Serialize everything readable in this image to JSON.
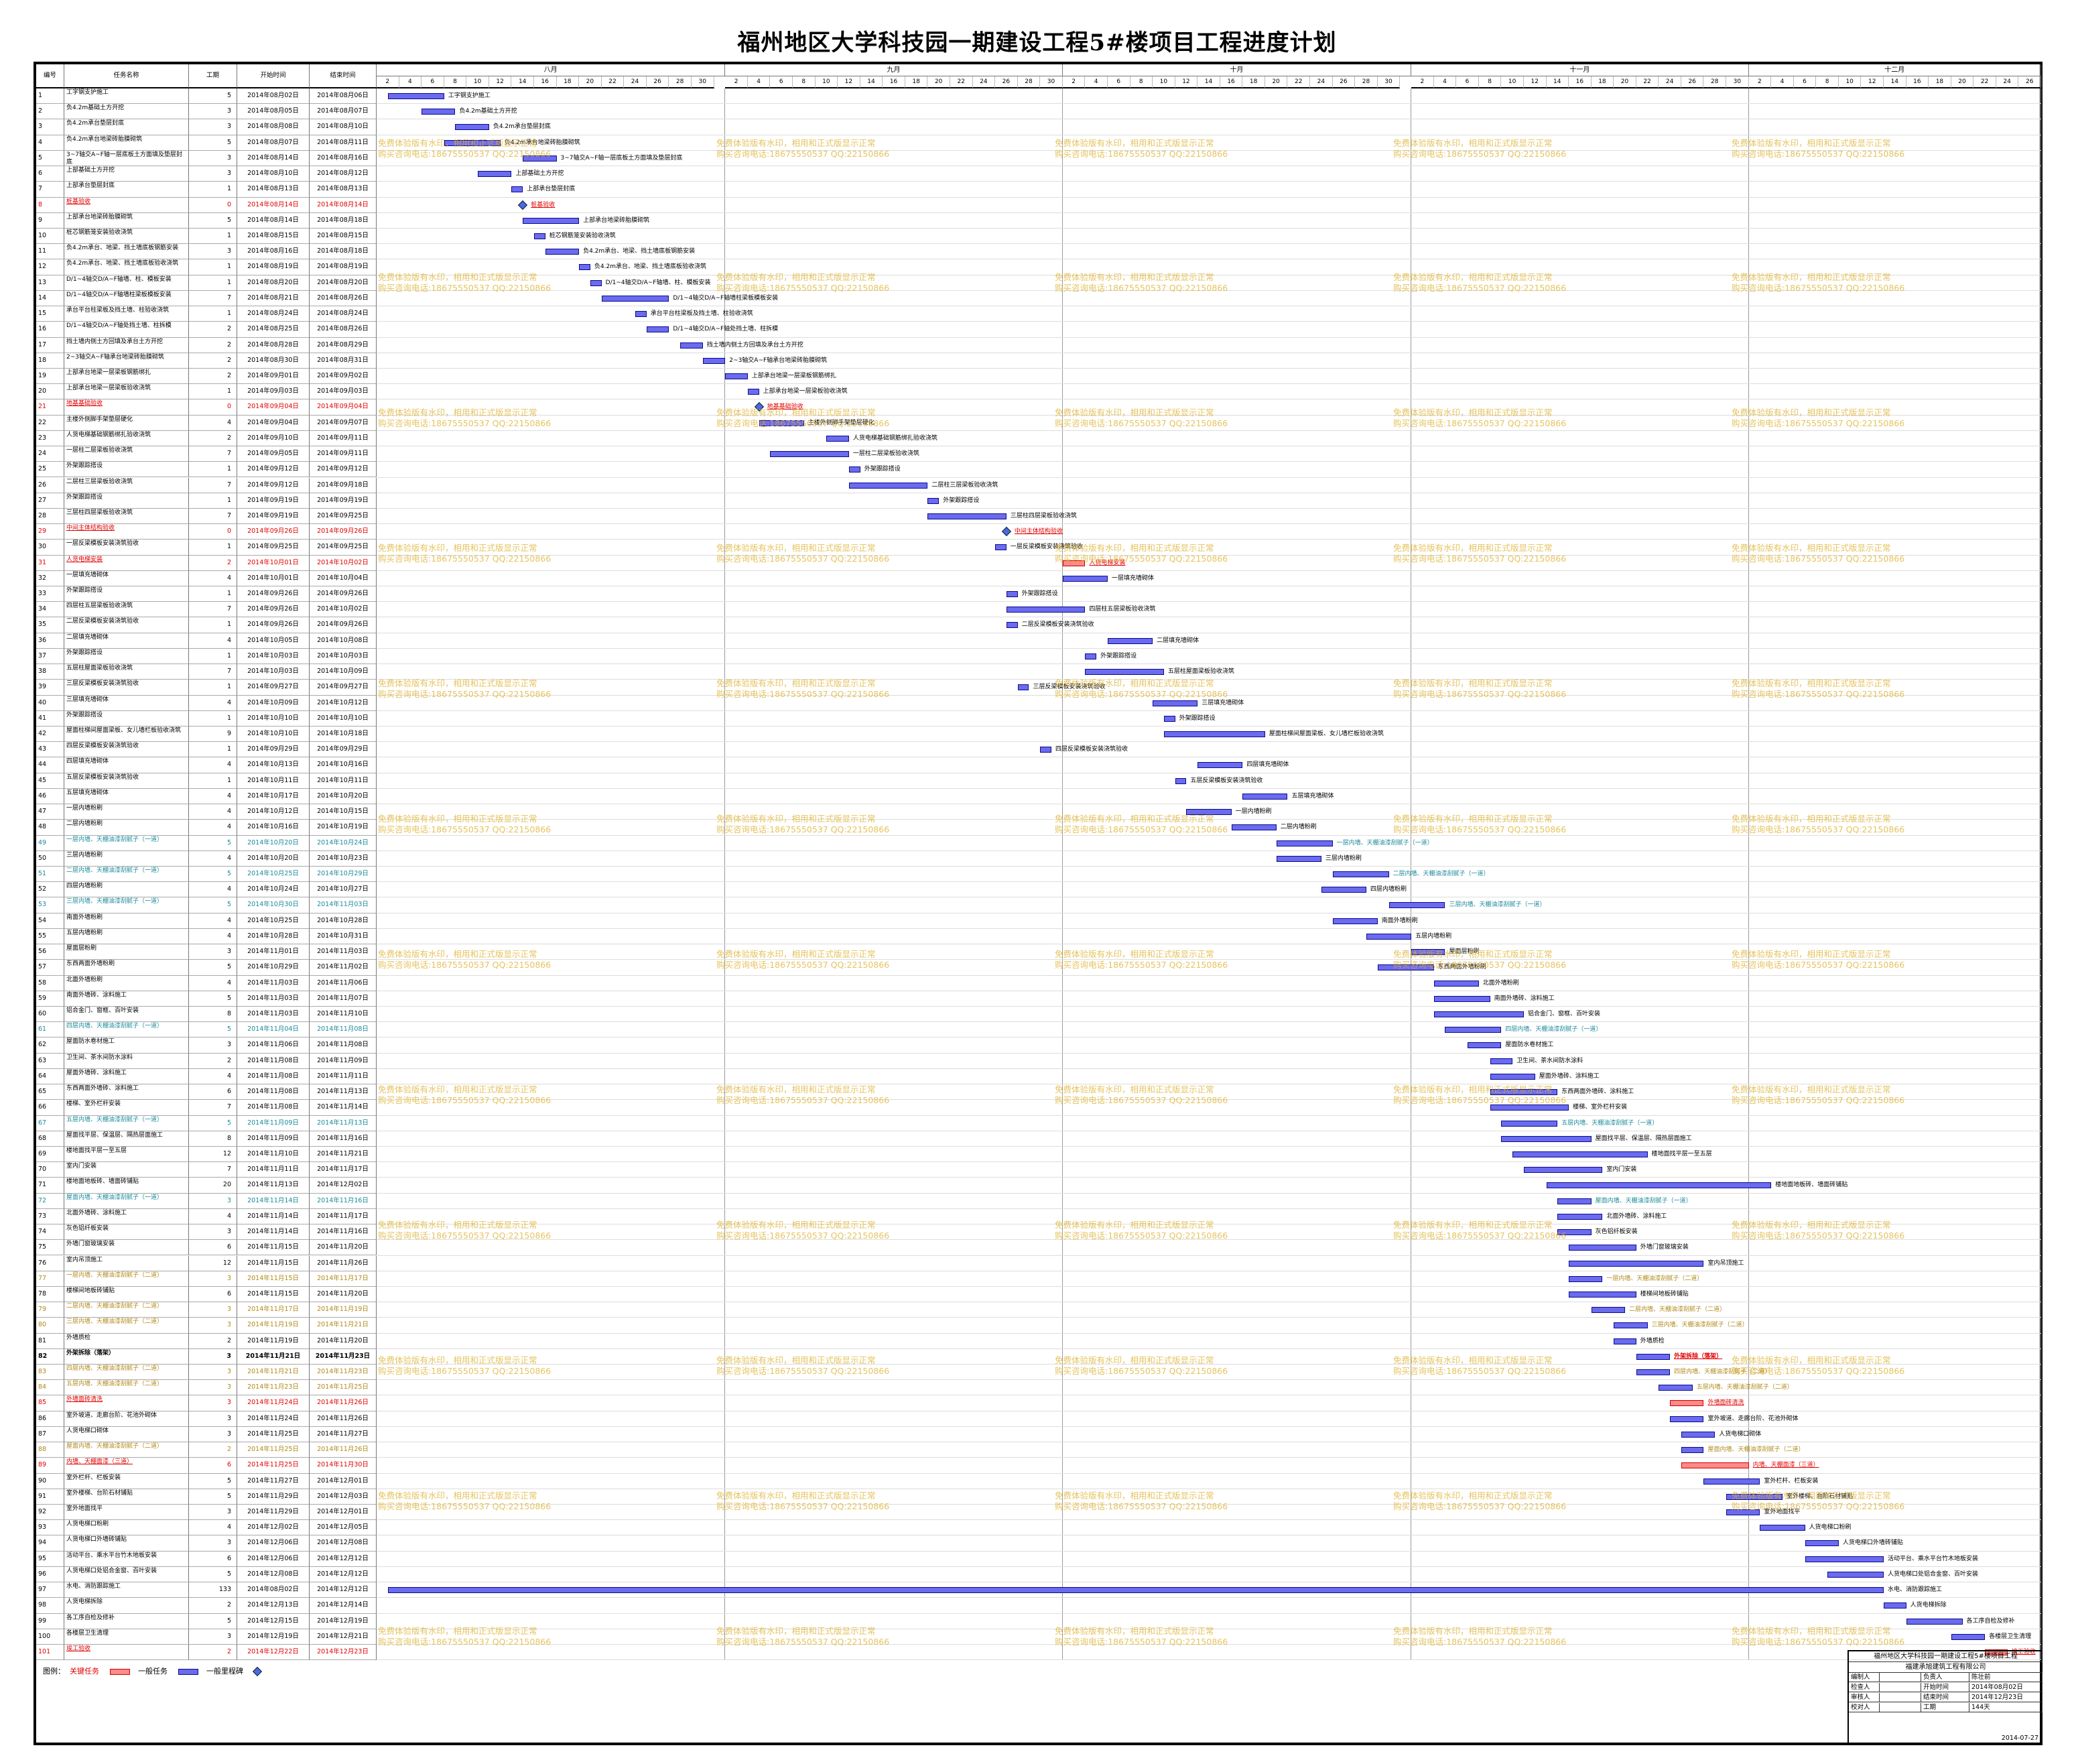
{
  "title": "福州地区大学科技园一期建设工程5#楼项目工程进度计划",
  "header": {
    "no": "编号",
    "name": "任务名称",
    "dur": "工期",
    "start": "开始时间",
    "end": "结束时间"
  },
  "timeline_start": "2014-08-01",
  "months": [
    {
      "label": "八月",
      "days": 31
    },
    {
      "label": "九月",
      "days": 30
    },
    {
      "label": "十月",
      "days": 31
    },
    {
      "label": "十一月",
      "days": 30
    },
    {
      "label": "十二月",
      "days": 26
    }
  ],
  "watermark": {
    "line1": "免费体验版有水印，相用和正式版显示正常",
    "line2": "购买咨询电话:18675550537 QQ:22150866"
  },
  "tasks": [
    {
      "no": "1",
      "name": "工字钢支护施工",
      "dur": "5",
      "start": "2014年08月02日",
      "end": "2014年08月06日"
    },
    {
      "no": "2",
      "name": "负4.2m基础土方开挖",
      "dur": "3",
      "start": "2014年08月05日",
      "end": "2014年08月07日"
    },
    {
      "no": "3",
      "name": "负4.2m承台垫层封底",
      "dur": "3",
      "start": "2014年08月08日",
      "end": "2014年08月10日"
    },
    {
      "no": "4",
      "name": "负4.2m承台地梁砖胎膜砌筑",
      "dur": "5",
      "start": "2014年08月07日",
      "end": "2014年08月11日"
    },
    {
      "no": "5",
      "name": "3~7轴交A~F轴一层底板土方面填及垫层封底",
      "dur": "3",
      "start": "2014年08月14日",
      "end": "2014年08月16日"
    },
    {
      "no": "6",
      "name": "上部基础土方开挖",
      "dur": "3",
      "start": "2014年08月10日",
      "end": "2014年08月12日"
    },
    {
      "no": "7",
      "name": "上部承台垫层封底",
      "dur": "1",
      "start": "2014年08月13日",
      "end": "2014年08月13日"
    },
    {
      "no": "8",
      "name": "桩基验收",
      "dur": "0",
      "start": "2014年08月14日",
      "end": "2014年08月14日",
      "type": "crit"
    },
    {
      "no": "9",
      "name": "上部承台地梁砖胎膜砌筑",
      "dur": "5",
      "start": "2014年08月14日",
      "end": "2014年08月18日"
    },
    {
      "no": "10",
      "name": "桩芯钢筋笼安装验收浇筑",
      "dur": "1",
      "start": "2014年08月15日",
      "end": "2014年08月15日"
    },
    {
      "no": "11",
      "name": "负4.2m承台、地梁、挡土墙底板钢筋安装",
      "dur": "3",
      "start": "2014年08月16日",
      "end": "2014年08月18日"
    },
    {
      "no": "12",
      "name": "负4.2m承台、地梁、挡土墙底板验收浇筑",
      "dur": "1",
      "start": "2014年08月19日",
      "end": "2014年08月19日"
    },
    {
      "no": "13",
      "name": "D/1~4轴交D/A~F轴墙、柱、模板安装",
      "dur": "1",
      "start": "2014年08月20日",
      "end": "2014年08月20日"
    },
    {
      "no": "14",
      "name": "D/1~4轴交D/A~F轴墙柱梁板模板安装",
      "dur": "7",
      "start": "2014年08月21日",
      "end": "2014年08月26日"
    },
    {
      "no": "15",
      "name": "承台平台柱梁板及挡土墙、柱验收浇筑",
      "dur": "1",
      "start": "2014年08月24日",
      "end": "2014年08月24日"
    },
    {
      "no": "16",
      "name": "D/1~4轴交D/A~F轴处挡土墙、柱拆模",
      "dur": "2",
      "start": "2014年08月25日",
      "end": "2014年08月26日"
    },
    {
      "no": "17",
      "name": "挡土墙内侧土方回填及承台土方开挖",
      "dur": "2",
      "start": "2014年08月28日",
      "end": "2014年08月29日"
    },
    {
      "no": "18",
      "name": "2~3轴交A~F轴承台地梁砖胎膜砌筑",
      "dur": "2",
      "start": "2014年08月30日",
      "end": "2014年08月31日"
    },
    {
      "no": "19",
      "name": "上部承台地梁一层梁板钢筋绑扎",
      "dur": "2",
      "start": "2014年09月01日",
      "end": "2014年09月02日"
    },
    {
      "no": "20",
      "name": "上部承台地梁一层梁板验收浇筑",
      "dur": "1",
      "start": "2014年09月03日",
      "end": "2014年09月03日"
    },
    {
      "no": "21",
      "name": "地基基础验收",
      "dur": "0",
      "start": "2014年09月04日",
      "end": "2014年09月04日",
      "type": "crit"
    },
    {
      "no": "22",
      "name": "主楼外侧脚手架垫层硬化",
      "dur": "4",
      "start": "2014年09月04日",
      "end": "2014年09月07日"
    },
    {
      "no": "23",
      "name": "人货电梯基础钢筋绑扎验收浇筑",
      "dur": "2",
      "start": "2014年09月10日",
      "end": "2014年09月11日"
    },
    {
      "no": "24",
      "name": "一层柱二层梁板验收浇筑",
      "dur": "7",
      "start": "2014年09月05日",
      "end": "2014年09月11日"
    },
    {
      "no": "25",
      "name": "外架跟踪搭设",
      "dur": "1",
      "start": "2014年09月12日",
      "end": "2014年09月12日"
    },
    {
      "no": "26",
      "name": "二层柱三层梁板验收浇筑",
      "dur": "7",
      "start": "2014年09月12日",
      "end": "2014年09月18日"
    },
    {
      "no": "27",
      "name": "外架跟踪搭设",
      "dur": "1",
      "start": "2014年09月19日",
      "end": "2014年09月19日"
    },
    {
      "no": "28",
      "name": "三层柱四层梁板验收浇筑",
      "dur": "7",
      "start": "2014年09月19日",
      "end": "2014年09月25日"
    },
    {
      "no": "29",
      "name": "中间主体结构验收",
      "dur": "0",
      "start": "2014年09月26日",
      "end": "2014年09月26日",
      "type": "crit"
    },
    {
      "no": "30",
      "name": "一层反梁模板安装浇筑验收",
      "dur": "1",
      "start": "2014年09月25日",
      "end": "2014年09月25日"
    },
    {
      "no": "31",
      "name": "人货电梯安装",
      "dur": "2",
      "start": "2014年10月01日",
      "end": "2014年10月02日",
      "type": "crit"
    },
    {
      "no": "32",
      "name": "一层填充墙砌体",
      "dur": "4",
      "start": "2014年10月01日",
      "end": "2014年10月04日"
    },
    {
      "no": "33",
      "name": "外架跟踪搭设",
      "dur": "1",
      "start": "2014年09月26日",
      "end": "2014年09月26日"
    },
    {
      "no": "34",
      "name": "四层柱五层梁板验收浇筑",
      "dur": "7",
      "start": "2014年09月26日",
      "end": "2014年10月02日"
    },
    {
      "no": "35",
      "name": "二层反梁模板安装浇筑验收",
      "dur": "1",
      "start": "2014年09月26日",
      "end": "2014年09月26日"
    },
    {
      "no": "36",
      "name": "二层填充墙砌体",
      "dur": "4",
      "start": "2014年10月05日",
      "end": "2014年10月08日"
    },
    {
      "no": "37",
      "name": "外架跟踪搭设",
      "dur": "1",
      "start": "2014年10月03日",
      "end": "2014年10月03日"
    },
    {
      "no": "38",
      "name": "五层柱屋面梁板验收浇筑",
      "dur": "7",
      "start": "2014年10月03日",
      "end": "2014年10月09日"
    },
    {
      "no": "39",
      "name": "三层反梁模板安装浇筑验收",
      "dur": "1",
      "start": "2014年09月27日",
      "end": "2014年09月27日"
    },
    {
      "no": "40",
      "name": "三层填充墙砌体",
      "dur": "4",
      "start": "2014年10月09日",
      "end": "2014年10月12日"
    },
    {
      "no": "41",
      "name": "外架跟踪搭设",
      "dur": "1",
      "start": "2014年10月10日",
      "end": "2014年10月10日"
    },
    {
      "no": "42",
      "name": "屋面柱梯间屋面梁板、女儿墙栏板验收浇筑",
      "dur": "9",
      "start": "2014年10月10日",
      "end": "2014年10月18日"
    },
    {
      "no": "43",
      "name": "四层反梁模板安装浇筑验收",
      "dur": "1",
      "start": "2014年09月29日",
      "end": "2014年09月29日"
    },
    {
      "no": "44",
      "name": "四层填充墙砌体",
      "dur": "4",
      "start": "2014年10月13日",
      "end": "2014年10月16日"
    },
    {
      "no": "45",
      "name": "五层反梁模板安装浇筑验收",
      "dur": "1",
      "start": "2014年10月11日",
      "end": "2014年10月11日"
    },
    {
      "no": "46",
      "name": "五层填充墙砌体",
      "dur": "4",
      "start": "2014年10月17日",
      "end": "2014年10月20日"
    },
    {
      "no": "47",
      "name": "一层内墙粉刷",
      "dur": "4",
      "start": "2014年10月12日",
      "end": "2014年10月15日"
    },
    {
      "no": "48",
      "name": "二层内墙粉刷",
      "dur": "4",
      "start": "2014年10月16日",
      "end": "2014年10月19日"
    },
    {
      "no": "49",
      "name": "一层内墙、天棚油漆刮腻子（一道）",
      "dur": "5",
      "start": "2014年10月20日",
      "end": "2014年10月24日",
      "type": "cyan"
    },
    {
      "no": "50",
      "name": "三层内墙粉刷",
      "dur": "4",
      "start": "2014年10月20日",
      "end": "2014年10月23日"
    },
    {
      "no": "51",
      "name": "二层内墙、天棚油漆刮腻子（一道）",
      "dur": "5",
      "start": "2014年10月25日",
      "end": "2014年10月29日",
      "type": "cyan"
    },
    {
      "no": "52",
      "name": "四层内墙粉刷",
      "dur": "4",
      "start": "2014年10月24日",
      "end": "2014年10月27日"
    },
    {
      "no": "53",
      "name": "三层内墙、天棚油漆刮腻子（一道）",
      "dur": "5",
      "start": "2014年10月30日",
      "end": "2014年11月03日",
      "type": "cyan"
    },
    {
      "no": "54",
      "name": "南面外墙粉刷",
      "dur": "4",
      "start": "2014年10月25日",
      "end": "2014年10月28日"
    },
    {
      "no": "55",
      "name": "五层内墙粉刷",
      "dur": "4",
      "start": "2014年10月28日",
      "end": "2014年10月31日"
    },
    {
      "no": "56",
      "name": "屋面层粉刷",
      "dur": "3",
      "start": "2014年11月01日",
      "end": "2014年11月03日"
    },
    {
      "no": "57",
      "name": "东西两面外墙粉刷",
      "dur": "5",
      "start": "2014年10月29日",
      "end": "2014年11月02日"
    },
    {
      "no": "58",
      "name": "北面外墙粉刷",
      "dur": "4",
      "start": "2014年11月03日",
      "end": "2014年11月06日"
    },
    {
      "no": "59",
      "name": "南面外墙砖、涂料施工",
      "dur": "5",
      "start": "2014年11月03日",
      "end": "2014年11月07日"
    },
    {
      "no": "60",
      "name": "铝合金门、窗框、百叶安装",
      "dur": "8",
      "start": "2014年11月03日",
      "end": "2014年11月10日"
    },
    {
      "no": "61",
      "name": "四层内墙、天棚油漆刮腻子（一道）",
      "dur": "5",
      "start": "2014年11月04日",
      "end": "2014年11月08日",
      "type": "cyan"
    },
    {
      "no": "62",
      "name": "屋面防水卷材施工",
      "dur": "3",
      "start": "2014年11月06日",
      "end": "2014年11月08日"
    },
    {
      "no": "63",
      "name": "卫生间、茶水间防水涂料",
      "dur": "2",
      "start": "2014年11月08日",
      "end": "2014年11月09日"
    },
    {
      "no": "64",
      "name": "屋面外墙砖、涂料施工",
      "dur": "4",
      "start": "2014年11月08日",
      "end": "2014年11月11日"
    },
    {
      "no": "65",
      "name": "东西两面外墙砖、涂料施工",
      "dur": "6",
      "start": "2014年11月08日",
      "end": "2014年11月13日"
    },
    {
      "no": "66",
      "name": "楼梯、室外栏杆安装",
      "dur": "7",
      "start": "2014年11月08日",
      "end": "2014年11月14日"
    },
    {
      "no": "67",
      "name": "五层内墙、天棚油漆刮腻子（一道）",
      "dur": "5",
      "start": "2014年11月09日",
      "end": "2014年11月13日",
      "type": "cyan"
    },
    {
      "no": "68",
      "name": "屋面找平层、保温层、隔热层面施工",
      "dur": "8",
      "start": "2014年11月09日",
      "end": "2014年11月16日"
    },
    {
      "no": "69",
      "name": "楼地面找平层一至五层",
      "dur": "12",
      "start": "2014年11月10日",
      "end": "2014年11月21日"
    },
    {
      "no": "70",
      "name": "室内门安装",
      "dur": "7",
      "start": "2014年11月11日",
      "end": "2014年11月17日"
    },
    {
      "no": "71",
      "name": "楼地面地板砖、墙面砖铺贴",
      "dur": "20",
      "start": "2014年11月13日",
      "end": "2014年12月02日"
    },
    {
      "no": "72",
      "name": "屋面内墙、天棚油漆刮腻子（一道）",
      "dur": "3",
      "start": "2014年11月14日",
      "end": "2014年11月16日",
      "type": "cyan"
    },
    {
      "no": "73",
      "name": "北面外墙砖、涂料施工",
      "dur": "4",
      "start": "2014年11月14日",
      "end": "2014年11月17日"
    },
    {
      "no": "74",
      "name": "灰色铝纤板安装",
      "dur": "3",
      "start": "2014年11月14日",
      "end": "2014年11月16日"
    },
    {
      "no": "75",
      "name": "外墙门窗玻璃安装",
      "dur": "6",
      "start": "2014年11月15日",
      "end": "2014年11月20日"
    },
    {
      "no": "76",
      "name": "室内吊顶施工",
      "dur": "12",
      "start": "2014年11月15日",
      "end": "2014年11月26日"
    },
    {
      "no": "77",
      "name": "一层内墙、天棚油漆刮腻子（二道）",
      "dur": "3",
      "start": "2014年11月15日",
      "end": "2014年11月17日",
      "type": "olive"
    },
    {
      "no": "78",
      "name": "楼梯间地板砖铺贴",
      "dur": "6",
      "start": "2014年11月15日",
      "end": "2014年11月20日"
    },
    {
      "no": "79",
      "name": "二层内墙、天棚油漆刮腻子（二道）",
      "dur": "3",
      "start": "2014年11月17日",
      "end": "2014年11月19日",
      "type": "olive"
    },
    {
      "no": "80",
      "name": "三层内墙、天棚油漆刮腻子（二道）",
      "dur": "3",
      "start": "2014年11月19日",
      "end": "2014年11月21日",
      "type": "olive"
    },
    {
      "no": "81",
      "name": "外墙质检",
      "dur": "2",
      "start": "2014年11月19日",
      "end": "2014年11月20日"
    },
    {
      "no": "82",
      "name": "外架拆除（落架）",
      "dur": "3",
      "start": "2014年11月21日",
      "end": "2014年11月23日",
      "type": "bold"
    },
    {
      "no": "83",
      "name": "四层内墙、天棚油漆刮腻子（二道）",
      "dur": "3",
      "start": "2014年11月21日",
      "end": "2014年11月23日",
      "type": "olive"
    },
    {
      "no": "84",
      "name": "五层内墙、天棚油漆刮腻子（二道）",
      "dur": "3",
      "start": "2014年11月23日",
      "end": "2014年11月25日",
      "type": "olive"
    },
    {
      "no": "85",
      "name": "外墙面砖清洗",
      "dur": "3",
      "start": "2014年11月24日",
      "end": "2014年11月26日",
      "type": "crit"
    },
    {
      "no": "86",
      "name": "室外坡道、走廊台阶、花池外砌体",
      "dur": "3",
      "start": "2014年11月24日",
      "end": "2014年11月26日"
    },
    {
      "no": "87",
      "name": "人货电梯口砌体",
      "dur": "3",
      "start": "2014年11月25日",
      "end": "2014年11月27日"
    },
    {
      "no": "88",
      "name": "屋面内墙、天棚油漆刮腻子（二道）",
      "dur": "2",
      "start": "2014年11月25日",
      "end": "2014年11月26日",
      "type": "olive"
    },
    {
      "no": "89",
      "name": "内墙、天棚面漆（三道）",
      "dur": "6",
      "start": "2014年11月25日",
      "end": "2014年11月30日",
      "type": "crit"
    },
    {
      "no": "90",
      "name": "室外栏杆、栏板安装",
      "dur": "5",
      "start": "2014年11月27日",
      "end": "2014年12月01日"
    },
    {
      "no": "91",
      "name": "室外楼梯、台阶石材铺贴",
      "dur": "5",
      "start": "2014年11月29日",
      "end": "2014年12月03日"
    },
    {
      "no": "92",
      "name": "室外地面找平",
      "dur": "3",
      "start": "2014年11月29日",
      "end": "2014年12月01日"
    },
    {
      "no": "93",
      "name": "人货电梯口粉刷",
      "dur": "4",
      "start": "2014年12月02日",
      "end": "2014年12月05日"
    },
    {
      "no": "94",
      "name": "人货电梯口外墙砖铺贴",
      "dur": "3",
      "start": "2014年12月06日",
      "end": "2014年12月08日"
    },
    {
      "no": "95",
      "name": "活动平台、乘水平台竹木地板安装",
      "dur": "6",
      "start": "2014年12月06日",
      "end": "2014年12月12日"
    },
    {
      "no": "96",
      "name": "人货电梯口处铝合金窗、百叶安装",
      "dur": "5",
      "start": "2014年12月08日",
      "end": "2014年12月12日"
    },
    {
      "no": "97",
      "name": "水电、消防跟踪施工",
      "dur": "133",
      "start": "2014年08月02日",
      "end": "2014年12月12日"
    },
    {
      "no": "98",
      "name": "人货电梯拆除",
      "dur": "2",
      "start": "2014年12月13日",
      "end": "2014年12月14日"
    },
    {
      "no": "99",
      "name": "各工序自检及修补",
      "dur": "5",
      "start": "2014年12月15日",
      "end": "2014年12月19日"
    },
    {
      "no": "100",
      "name": "各楼层卫生清理",
      "dur": "3",
      "start": "2014年12月19日",
      "end": "2014年12月21日"
    },
    {
      "no": "101",
      "name": "竣工验收",
      "dur": "2",
      "start": "2014年12月22日",
      "end": "2014年12月23日",
      "type": "crit"
    }
  ],
  "legend": {
    "label": "图例：",
    "crit": "关键任务",
    "normal": "一般任务",
    "milestone": "一般里程碑"
  },
  "info": {
    "project": "福州地区大学科技园一期建设工程5#楼项目工程",
    "company": "福建承旭建筑工程有限公司",
    "rows": [
      {
        "a": "编制人",
        "b": "",
        "c": "负责人",
        "d": "陈壮前"
      },
      {
        "a": "检查人",
        "b": "",
        "c": "开始时间",
        "d": "2014年08月02日"
      },
      {
        "a": "审核人",
        "b": "",
        "c": "结束时间",
        "d": "2014年12月23日"
      },
      {
        "a": "校对人",
        "b": "",
        "c": "工期",
        "d": "144天"
      }
    ],
    "date": "2014-07-27"
  },
  "colors": {
    "bar": "#6b6bf0",
    "crit": "#ff8a8a",
    "milestone": "#4a6ae0",
    "watermark": "#dcaf28"
  }
}
